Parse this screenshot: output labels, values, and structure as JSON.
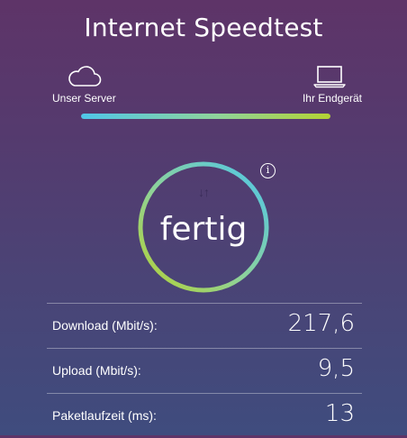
{
  "header": {
    "title": "Internet Speedtest"
  },
  "endpoints": {
    "server": {
      "label": "Unser Server",
      "icon": "cloud-icon"
    },
    "device": {
      "label": "Ihr Endgerät",
      "icon": "laptop-icon"
    }
  },
  "progress": {
    "fraction": 1.0,
    "gradient": [
      "#4fc6e8",
      "#b4d233"
    ]
  },
  "gauge": {
    "status": "fertig",
    "icon": "up-down-arrows-icon",
    "info_icon": "info-icon",
    "info_glyph": "i",
    "arrows_glyph": "↓↑"
  },
  "results": [
    {
      "label": "Download (Mbit/s):",
      "value": "217,6"
    },
    {
      "label": "Upload (Mbit/s):",
      "value": "9,5"
    },
    {
      "label": "Paketlaufzeit (ms):",
      "value": "13"
    }
  ],
  "colors": {
    "background_top": "#5e3468",
    "background_bottom": "#3f4c7e",
    "accent_blue": "#4fc6e8",
    "accent_green": "#b4d233"
  }
}
